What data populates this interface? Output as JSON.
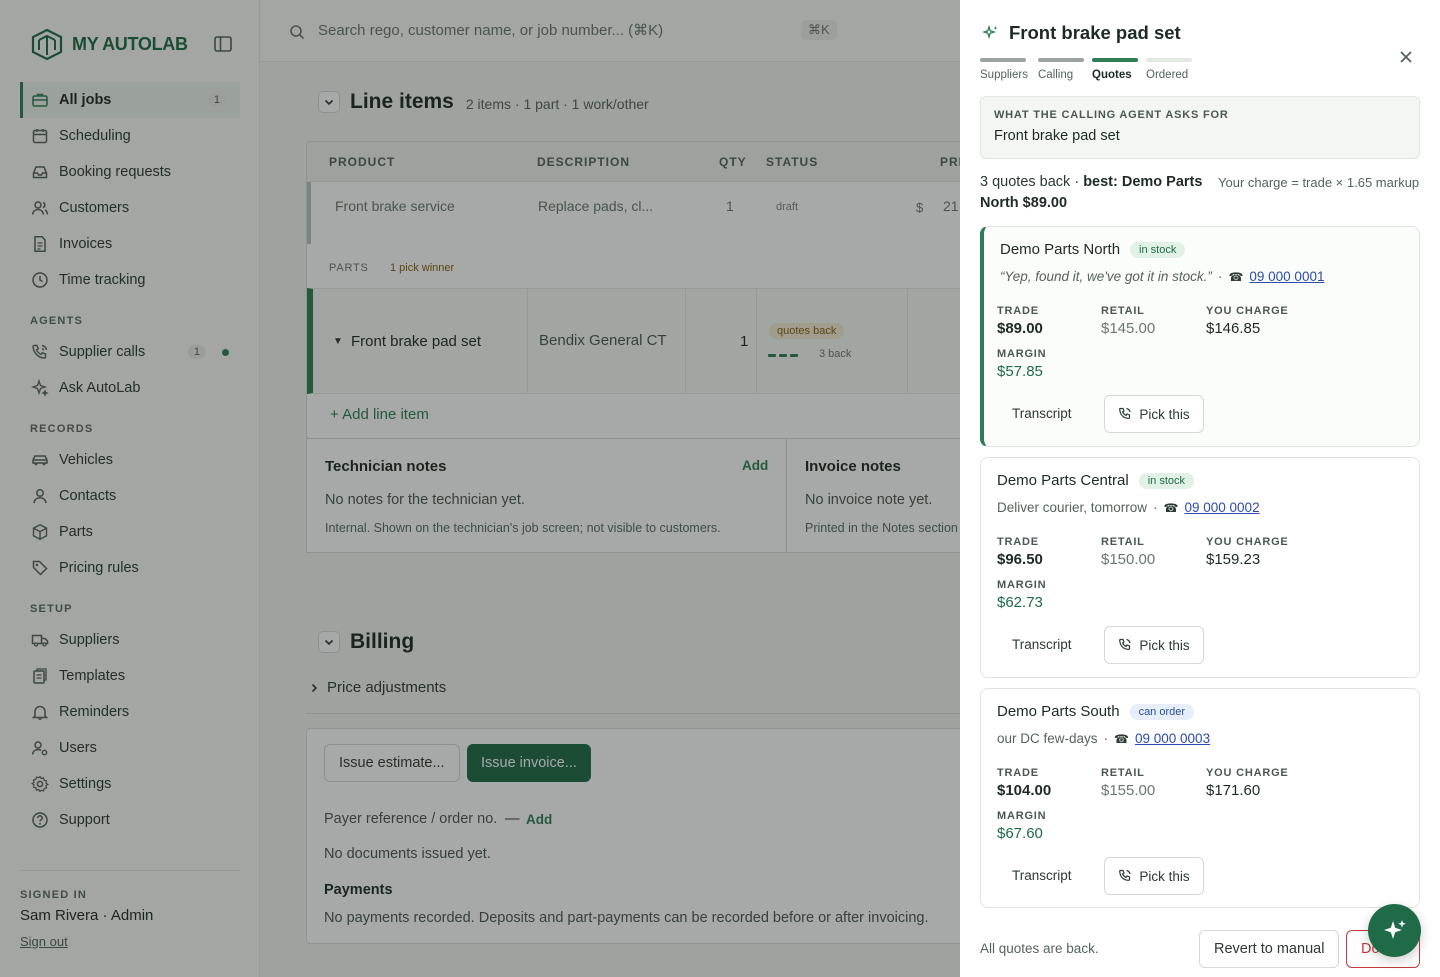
{
  "brand": {
    "name": "MY AUTOLAB"
  },
  "sidebar": {
    "items": [
      {
        "label": "All jobs",
        "count": "1"
      },
      {
        "label": "Scheduling"
      },
      {
        "label": "Booking requests"
      },
      {
        "label": "Customers"
      },
      {
        "label": "Invoices"
      },
      {
        "label": "Time tracking"
      }
    ],
    "agents_label": "AGENTS",
    "agents": [
      {
        "label": "Supplier calls",
        "count": "1"
      },
      {
        "label": "Ask AutoLab"
      }
    ],
    "records_label": "RECORDS",
    "records": [
      {
        "label": "Vehicles"
      },
      {
        "label": "Contacts"
      },
      {
        "label": "Parts"
      },
      {
        "label": "Pricing rules"
      }
    ],
    "setup_label": "SETUP",
    "setup": [
      {
        "label": "Suppliers"
      },
      {
        "label": "Templates"
      },
      {
        "label": "Reminders"
      },
      {
        "label": "Users"
      },
      {
        "label": "Settings"
      },
      {
        "label": "Support"
      }
    ],
    "signed_in_label": "SIGNED IN",
    "user": "Sam Rivera · Admin",
    "sign_out": "Sign out"
  },
  "search": {
    "placeholder": "Search rego, customer name, or job number... (⌘K)",
    "shortcut": "⌘K"
  },
  "line_items": {
    "title": "Line items",
    "meta": "2 items · 1 part · 1 work/other",
    "columns": [
      "PRODUCT",
      "DESCRIPTION",
      "QTY",
      "STATUS",
      "PRI"
    ],
    "row1": {
      "product": "Front brake service",
      "description": "Replace pads, cl...",
      "qty": "1",
      "status": "draft",
      "currency": "$",
      "price": "21"
    },
    "parts_label": "PARTS",
    "parts_badge": "1 pick winner",
    "row2": {
      "product": "Front brake pad set",
      "description": "Bendix General CT",
      "qty": "1",
      "status": "quotes back",
      "progress": "3 back"
    },
    "add_line": "+ Add line item"
  },
  "notes": {
    "tech_title": "Technician notes",
    "tech_add": "Add",
    "tech_empty": "No notes for the technician yet.",
    "tech_sub": "Internal. Shown on the technician's job screen; not visible to customers.",
    "invoice_title": "Invoice notes",
    "invoice_empty": "No invoice note yet.",
    "invoice_sub": "Printed in the Notes section"
  },
  "billing": {
    "title": "Billing",
    "price_adjustments": "Price adjustments",
    "issue_estimate": "Issue estimate...",
    "issue_invoice": "Issue invoice...",
    "payer_ref": "Payer reference / order no.",
    "payer_dash": "—",
    "payer_add": "Add",
    "no_docs": "No documents issued yet.",
    "payments_title": "Payments",
    "payments_text": "No payments recorded. Deposits and part-payments can be recorded before or after invoicing."
  },
  "panel": {
    "title": "Front brake pad set",
    "steps": [
      "Suppliers",
      "Calling",
      "Quotes",
      "Ordered"
    ],
    "ask_label": "WHAT THE CALLING AGENT ASKS FOR",
    "ask_value": "Front brake pad set",
    "summary_prefix": "3 quotes back",
    "summary_best": "best: Demo Parts North $89.00",
    "markup_note": "Your charge = trade × 1.65 markup",
    "labels": {
      "trade": "TRADE",
      "retail": "RETAIL",
      "you_charge": "YOU CHARGE",
      "margin": "MARGIN",
      "transcript": "Transcript",
      "pick": "Pick this"
    },
    "quotes": [
      {
        "name": "Demo Parts North",
        "stock": "in stock",
        "note": "“Yep, found it, we've got it in stock.”",
        "phone": "09 000 0001",
        "trade": "$89.00",
        "retail": "$145.00",
        "charge": "$146.85",
        "margin": "$57.85"
      },
      {
        "name": "Demo Parts Central",
        "stock": "in stock",
        "note": "Deliver  courier, tomorrow",
        "phone": "09 000 0002",
        "trade": "$96.50",
        "retail": "$150.00",
        "charge": "$159.23",
        "margin": "$62.73"
      },
      {
        "name": "Demo Parts South",
        "stock": "can order",
        "note": "our DC  few-days",
        "phone": "09 000 0003",
        "trade": "$104.00",
        "retail": "$155.00",
        "charge": "$171.60",
        "margin": "$67.60"
      }
    ],
    "footer": "All quotes are back.",
    "revert": "Revert to manual",
    "danger": "Do"
  },
  "colors": {
    "accent": "#1f6b48",
    "danger": "#c43b3b",
    "link": "#2d4bb0"
  }
}
